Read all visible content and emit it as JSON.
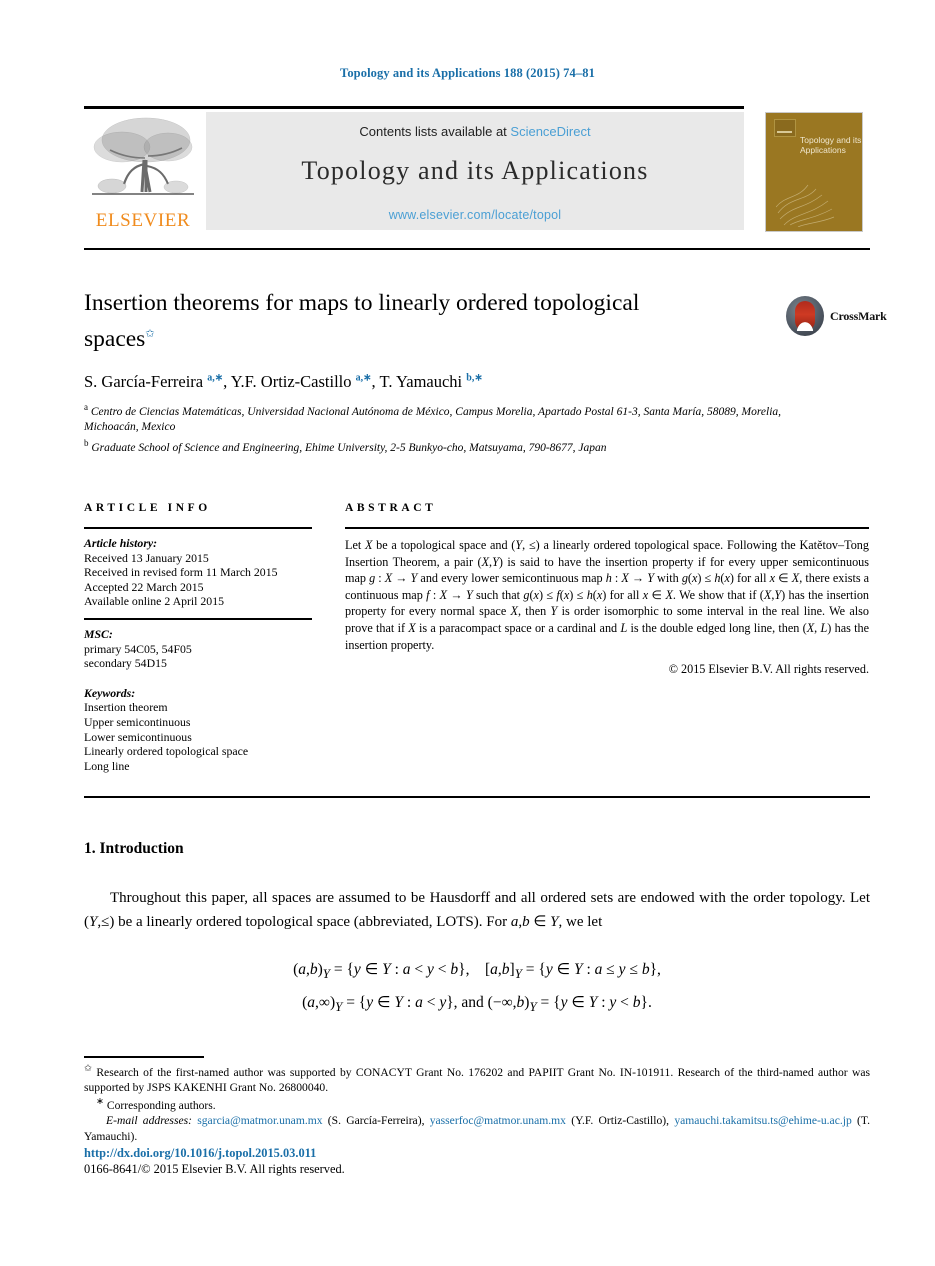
{
  "running_head": "Topology and its Applications 188 (2015) 74–81",
  "masthead": {
    "elsevier_wordmark": "ELSEVIER",
    "contents_prefix": "Contents lists available at ",
    "sciencedirect": "ScienceDirect",
    "journal_title": "Topology and its Applications",
    "journal_url": "www.elsevier.com/locate/topol",
    "cover_title": "Topology and its Applications",
    "colors": {
      "link_blue": "#4a9fd4",
      "elsevier_orange": "#f08b1d",
      "cover_olive": "#9a7722",
      "banner_grey": "#e9e9e9",
      "running_head_blue": "#1a6fa8"
    }
  },
  "article": {
    "title": "Insertion theorems for maps to linearly ordered topological spaces",
    "title_footnote_mark": "✩",
    "authors_html": "S. García-Ferreira <sup class=\"aff-mark\">a,∗</sup>, Y.F. Ortiz-Castillo <sup class=\"aff-mark\">a,∗</sup>, T. Yamauchi <sup class=\"aff-mark\">b,∗</sup>",
    "affiliations": [
      {
        "mark": "a",
        "text": "Centro de Ciencias Matemáticas, Universidad Nacional Autónoma de México, Campus Morelia, Apartado Postal 61-3, Santa María, 58089, Morelia, Michoacán, Mexico"
      },
      {
        "mark": "b",
        "text": "Graduate School of Science and Engineering, Ehime University, 2-5 Bunkyo-cho, Matsuyama, 790-8677, Japan"
      }
    ],
    "crossmark_label": "CrossMark"
  },
  "info": {
    "heading": "ARTICLE INFO",
    "history_label": "Article history:",
    "history": [
      "Received 13 January 2015",
      "Received in revised form 11 March 2015",
      "Accepted 22 March 2015",
      "Available online 2 April 2015"
    ],
    "msc_label": "MSC:",
    "msc": [
      "primary 54C05, 54F05",
      "secondary 54D15"
    ],
    "keywords_label": "Keywords:",
    "keywords": [
      "Insertion theorem",
      "Upper semicontinuous",
      "Lower semicontinuous",
      "Linearly ordered topological space",
      "Long line"
    ]
  },
  "abstract": {
    "heading": "ABSTRACT",
    "text_html": "Let <span class=\"mathvar\">X</span> be a topological space and (<span class=\"mathvar\">Y</span>, ≤) a linearly ordered topological space. Following the Katětov–Tong Insertion Theorem, a pair (<span class=\"mathvar\">X</span>,<span class=\"mathvar\">Y</span>) is said to have the insertion property if for every upper semicontinuous map <span class=\"mathvar\">g</span> : <span class=\"mathvar\">X</span> → <span class=\"mathvar\">Y</span> and every lower semicontinuous map <span class=\"mathvar\">h</span> : <span class=\"mathvar\">X</span> → <span class=\"mathvar\">Y</span> with <span class=\"mathvar\">g</span>(<span class=\"mathvar\">x</span>) ≤ <span class=\"mathvar\">h</span>(<span class=\"mathvar\">x</span>) for all <span class=\"mathvar\">x</span> ∈ <span class=\"mathvar\">X</span>, there exists a continuous map <span class=\"mathvar\">f</span> : <span class=\"mathvar\">X</span> → <span class=\"mathvar\">Y</span> such that <span class=\"mathvar\">g</span>(<span class=\"mathvar\">x</span>) ≤ <span class=\"mathvar\">f</span>(<span class=\"mathvar\">x</span>) ≤ <span class=\"mathvar\">h</span>(<span class=\"mathvar\">x</span>) for all <span class=\"mathvar\">x</span> ∈ <span class=\"mathvar\">X</span>. We show that if (<span class=\"mathvar\">X</span>,<span class=\"mathvar\">Y</span>) has the insertion property for every normal space <span class=\"mathvar\">X</span>, then <span class=\"mathvar\">Y</span> is order isomorphic to some interval in the real line. We also prove that if <span class=\"mathvar\">X</span> is a paracompact space or a cardinal and <span class=\"mathvar\">L</span> is the double edged long line, then (<span class=\"mathvar\">X</span>, <span class=\"mathvar\">L</span>) has the insertion property.",
    "copyright": "© 2015 Elsevier B.V. All rights reserved."
  },
  "body": {
    "section_title": "1. Introduction",
    "paragraph_html": "Throughout this paper, all spaces are assumed to be Hausdorff and all ordered sets are endowed with the order topology. Let (<span class=\"mathvar\">Y</span>,≤) be a linearly ordered topological space (abbreviated, LOTS). For <span class=\"mathvar\">a</span>,<span class=\"mathvar\">b</span> ∈ <span class=\"mathvar\">Y</span>, we let",
    "equations_html": "(<span class=\"mathvar\">a</span>,<span class=\"mathvar\">b</span>)<sub class=\"mathvar\">Y</sub> = {<span class=\"mathvar\">y</span> ∈ <span class=\"mathvar\">Y</span> : <span class=\"mathvar\">a</span> &lt; <span class=\"mathvar\">y</span> &lt; <span class=\"mathvar\">b</span>}, &nbsp;&nbsp; [<span class=\"mathvar\">a</span>,<span class=\"mathvar\">b</span>]<sub class=\"mathvar\">Y</sub> = {<span class=\"mathvar\">y</span> ∈ <span class=\"mathvar\">Y</span> : <span class=\"mathvar\">a</span> ≤ <span class=\"mathvar\">y</span> ≤ <span class=\"mathvar\">b</span>},<br>(<span class=\"mathvar\">a</span>,∞)<sub class=\"mathvar\">Y</sub> = {<span class=\"mathvar\">y</span> ∈ <span class=\"mathvar\">Y</span> : <span class=\"mathvar\">a</span> &lt; <span class=\"mathvar\">y</span>}, and (−∞,<span class=\"mathvar\">b</span>)<sub class=\"mathvar\">Y</sub> = {<span class=\"mathvar\">y</span> ∈ <span class=\"mathvar\">Y</span> : <span class=\"mathvar\">y</span> &lt; <span class=\"mathvar\">b</span>}."
  },
  "footnotes": {
    "funding_html": "<span class=\"fn-star\">✩</span> Research of the first-named author was supported by CONACYT Grant No. 176202 and PAPIIT Grant No. IN-101911. Research of the third-named author was supported by JSPS KAKENHI Grant No. 26800040.",
    "corresponding_html": "<span class=\"fn-star\">∗</span> Corresponding authors.",
    "emails_html": "<span class=\"em-label\">E-mail addresses:</span> <span class=\"link\">sgarcia@matmor.unam.mx</span> (S. García-Ferreira), <span class=\"link\">yasserfoc@matmor.unam.mx</span> (Y.F. Ortiz-Castillo), <span class=\"link\">yamauchi.takamitsu.ts@ehime-u.ac.jp</span> (T. Yamauchi).",
    "doi": "http://dx.doi.org/10.1016/j.topol.2015.03.011",
    "issn_line": "0166-8641/© 2015 Elsevier B.V. All rights reserved."
  }
}
